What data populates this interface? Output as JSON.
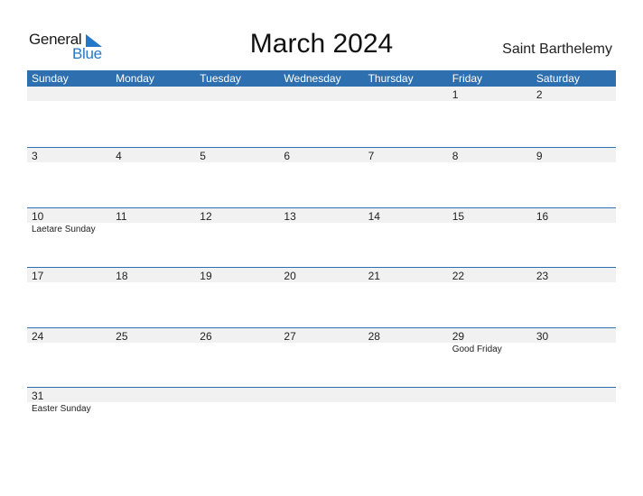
{
  "logo": {
    "line1": "General",
    "line2": "Blue"
  },
  "title": "March 2024",
  "region": "Saint Barthelemy",
  "colors": {
    "header_bg": "#2e6fb0",
    "date_strip": "#f1f1f1",
    "logo_blue": "#2577c8"
  },
  "weekdays": [
    "Sunday",
    "Monday",
    "Tuesday",
    "Wednesday",
    "Thursday",
    "Friday",
    "Saturday"
  ],
  "weeks": [
    [
      {
        "day": ""
      },
      {
        "day": ""
      },
      {
        "day": ""
      },
      {
        "day": ""
      },
      {
        "day": ""
      },
      {
        "day": "1"
      },
      {
        "day": "2"
      }
    ],
    [
      {
        "day": "3"
      },
      {
        "day": "4"
      },
      {
        "day": "5"
      },
      {
        "day": "6"
      },
      {
        "day": "7"
      },
      {
        "day": "8"
      },
      {
        "day": "9"
      }
    ],
    [
      {
        "day": "10",
        "event": "Laetare Sunday"
      },
      {
        "day": "11"
      },
      {
        "day": "12"
      },
      {
        "day": "13"
      },
      {
        "day": "14"
      },
      {
        "day": "15"
      },
      {
        "day": "16"
      }
    ],
    [
      {
        "day": "17"
      },
      {
        "day": "18"
      },
      {
        "day": "19"
      },
      {
        "day": "20"
      },
      {
        "day": "21"
      },
      {
        "day": "22"
      },
      {
        "day": "23"
      }
    ],
    [
      {
        "day": "24"
      },
      {
        "day": "25"
      },
      {
        "day": "26"
      },
      {
        "day": "27"
      },
      {
        "day": "28"
      },
      {
        "day": "29",
        "event": "Good Friday"
      },
      {
        "day": "30"
      }
    ],
    [
      {
        "day": "31",
        "event": "Easter Sunday"
      },
      {
        "day": ""
      },
      {
        "day": ""
      },
      {
        "day": ""
      },
      {
        "day": ""
      },
      {
        "day": ""
      },
      {
        "day": ""
      }
    ]
  ]
}
